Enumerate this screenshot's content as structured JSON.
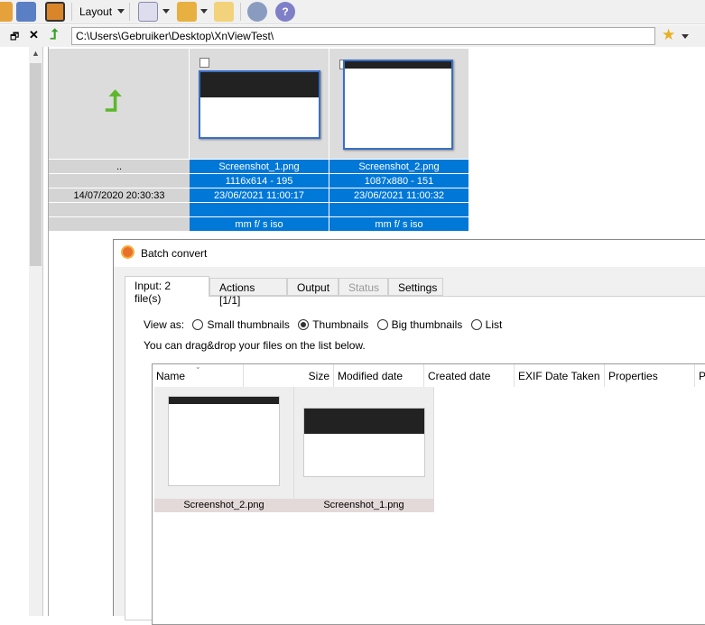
{
  "toolbar": {
    "layout_label": "Layout"
  },
  "address": {
    "path": "C:\\Users\\Gebruiker\\Desktop\\XnViewTest\\"
  },
  "browser": {
    "parent": {
      "name": "..",
      "date": "14/07/2020 20:30:33"
    },
    "files": [
      {
        "name": "Screenshot_1.png",
        "info": "1116x614 - 195",
        "date": "23/06/2021 11:00:17",
        "exif": "mm f/ s iso"
      },
      {
        "name": "Screenshot_2.png",
        "info": "1087x880 - 151",
        "date": "23/06/2021 11:00:32",
        "exif": "mm f/ s iso"
      }
    ]
  },
  "dialog": {
    "title": "Batch convert",
    "tabs": [
      "Input: 2 file(s)",
      "Actions [1/1]",
      "Output",
      "Status",
      "Settings"
    ],
    "view_as_label": "View as:",
    "view_options": [
      "Small thumbnails",
      "Thumbnails",
      "Big thumbnails",
      "List"
    ],
    "selected_view": "Thumbnails",
    "hint": "You can drag&drop your files on the list below.",
    "columns": [
      "Name",
      "Size",
      "Modified date",
      "Created date",
      "EXIF Date Taken",
      "Properties",
      "P"
    ],
    "items": [
      "Screenshot_2.png",
      "Screenshot_1.png"
    ]
  },
  "colors": {
    "selection": "#0078d7"
  }
}
